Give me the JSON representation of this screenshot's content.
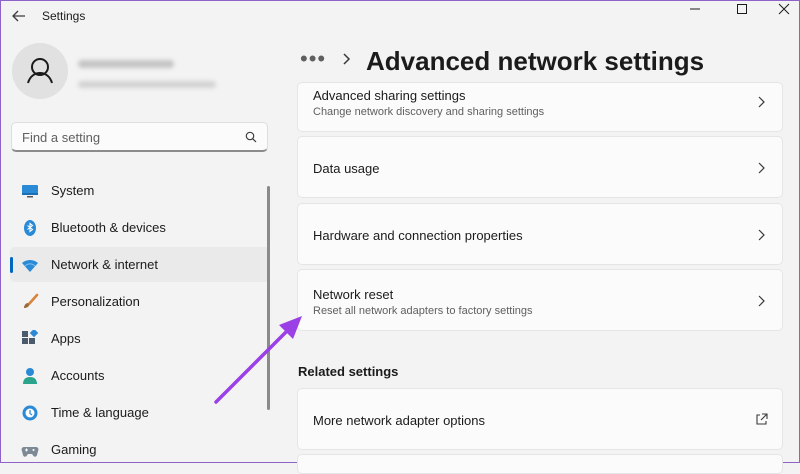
{
  "window": {
    "title": "Settings"
  },
  "search": {
    "placeholder": "Find a setting"
  },
  "sidebar": {
    "items": [
      {
        "label": "System",
        "icon": "monitor-icon"
      },
      {
        "label": "Bluetooth & devices",
        "icon": "bluetooth-icon"
      },
      {
        "label": "Network & internet",
        "icon": "wifi-icon",
        "selected": true
      },
      {
        "label": "Personalization",
        "icon": "brush-icon"
      },
      {
        "label": "Apps",
        "icon": "apps-icon"
      },
      {
        "label": "Accounts",
        "icon": "person-icon"
      },
      {
        "label": "Time & language",
        "icon": "globe-icon"
      },
      {
        "label": "Gaming",
        "icon": "gamepad-icon"
      }
    ]
  },
  "header": {
    "breadcrumb_dots": "•••",
    "page_title": "Advanced network settings"
  },
  "cards": [
    {
      "title": "Advanced sharing settings",
      "subtitle": "Change network discovery and sharing settings"
    },
    {
      "title": "Data usage"
    },
    {
      "title": "Hardware and connection properties"
    },
    {
      "title": "Network reset",
      "subtitle": "Reset all network adapters to factory settings"
    }
  ],
  "related": {
    "heading": "Related settings",
    "items": [
      {
        "title": "More network adapter options",
        "icon": "external-link-icon"
      }
    ]
  },
  "colors": {
    "accent": "#0067c0",
    "annotation_arrow": "#9b3fe6"
  }
}
